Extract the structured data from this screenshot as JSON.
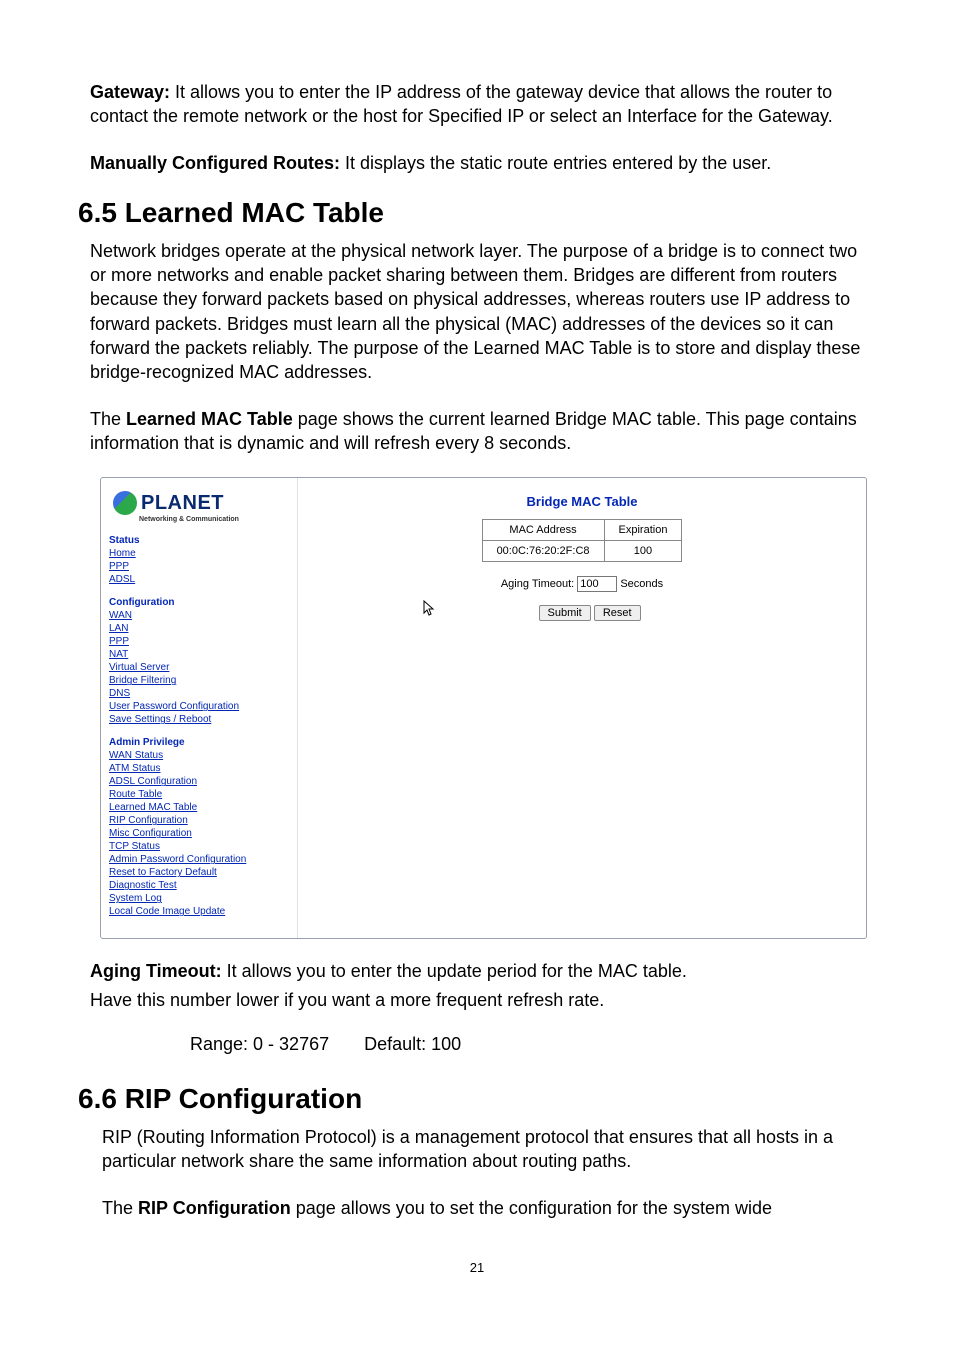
{
  "para_gateway": {
    "label": "Gateway:",
    "text": " It allows you to enter the IP address of the gateway device that allows the router to contact the remote network or the host for Specified IP or select an Interface for the Gateway."
  },
  "para_manual": {
    "label": "Manually Configured Routes:",
    "text": " It displays the static route entries entered by the user."
  },
  "section65": {
    "title": "6.5 Learned MAC Table",
    "p1": "Network bridges operate at the physical network layer. The purpose of a bridge is to connect two or more networks and enable packet sharing between them. Bridges are different from routers because they forward packets based on physical addresses, whereas routers use IP address to forward packets. Bridges must learn all the physical (MAC) addresses of the devices so it can forward the packets reliably. The purpose of the Learned MAC Table is to store and display these bridge-recognized MAC addresses.",
    "p2a": "The ",
    "p2b": "Learned MAC Table",
    "p2c": " page shows the current learned Bridge MAC table. This page contains information that is dynamic and will refresh every 8 seconds."
  },
  "screenshot": {
    "logo_text": "PLANET",
    "logo_tag": "Networking & Communication",
    "nav": {
      "status_title": "Status",
      "status": [
        "Home",
        "PPP",
        "ADSL"
      ],
      "config_title": "Configuration",
      "config": [
        "WAN",
        "LAN",
        "PPP",
        "NAT",
        "Virtual Server",
        "Bridge Filtering",
        "DNS",
        "User Password Configuration",
        "Save Settings / Reboot"
      ],
      "admin_title": "Admin Privilege",
      "admin": [
        "WAN Status",
        "ATM Status",
        "ADSL Configuration",
        "Route Table",
        "Learned MAC Table",
        "RIP Configuration",
        "Misc Configuration",
        "TCP Status",
        "Admin Password Configuration",
        "Reset to Factory Default",
        "Diagnostic Test",
        "System Log",
        "Local Code Image Update"
      ]
    },
    "main": {
      "title": "Bridge MAC Table",
      "th_mac": "MAC Address",
      "th_exp": "Expiration",
      "row_mac": "00:0C:76:20:2F:C8",
      "row_exp": "100",
      "aging_label": "Aging Timeout:",
      "aging_value": "100",
      "aging_unit": "Seconds",
      "submit": "Submit",
      "reset": "Reset"
    }
  },
  "aging_para": {
    "label": "Aging Timeout:",
    "text": " It allows you to enter the update period for the MAC table.",
    "line2": "Have this number lower if you want a more frequent refresh rate."
  },
  "range_line": "Range: 0 - 32767       Default: 100",
  "section66": {
    "title": "6.6 RIP Configuration",
    "p1": "RIP (Routing Information Protocol) is a management protocol that ensures that all hosts in a particular network share the same information about routing paths.",
    "p2a": "The ",
    "p2b": "RIP Configuration",
    "p2c": " page allows you to set the configuration for the system wide"
  },
  "pagenum": "21"
}
